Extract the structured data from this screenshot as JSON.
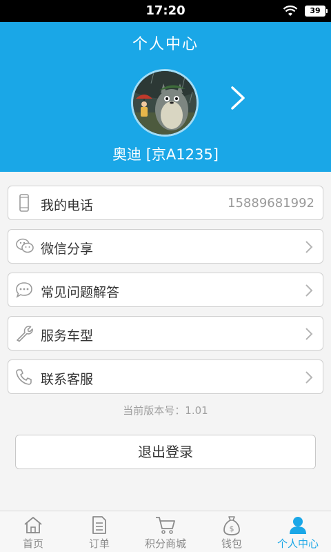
{
  "status_bar": {
    "time": "17:20",
    "battery": "39"
  },
  "header": {
    "title": "个人中心",
    "username": "奥迪 [京A1235]"
  },
  "rows": [
    {
      "label": "我的电话",
      "value": "15889681992",
      "icon": "phone-icon"
    },
    {
      "label": "微信分享",
      "icon": "wechat-icon"
    },
    {
      "label": "常见问题解答",
      "icon": "chat-bubble-icon"
    },
    {
      "label": "服务车型",
      "icon": "wrench-icon"
    },
    {
      "label": "联系客服",
      "icon": "telephone-handset-icon"
    }
  ],
  "version_text": "当前版本号：1.01",
  "logout_label": "退出登录",
  "tabs": [
    {
      "label": "首页",
      "icon": "home-icon"
    },
    {
      "label": "订单",
      "icon": "document-icon"
    },
    {
      "label": "积分商城",
      "icon": "cart-icon"
    },
    {
      "label": "钱包",
      "icon": "money-bag-icon"
    },
    {
      "label": "个人中心",
      "icon": "person-icon",
      "active": true
    }
  ],
  "colors": {
    "accent": "#1aa7e7"
  }
}
